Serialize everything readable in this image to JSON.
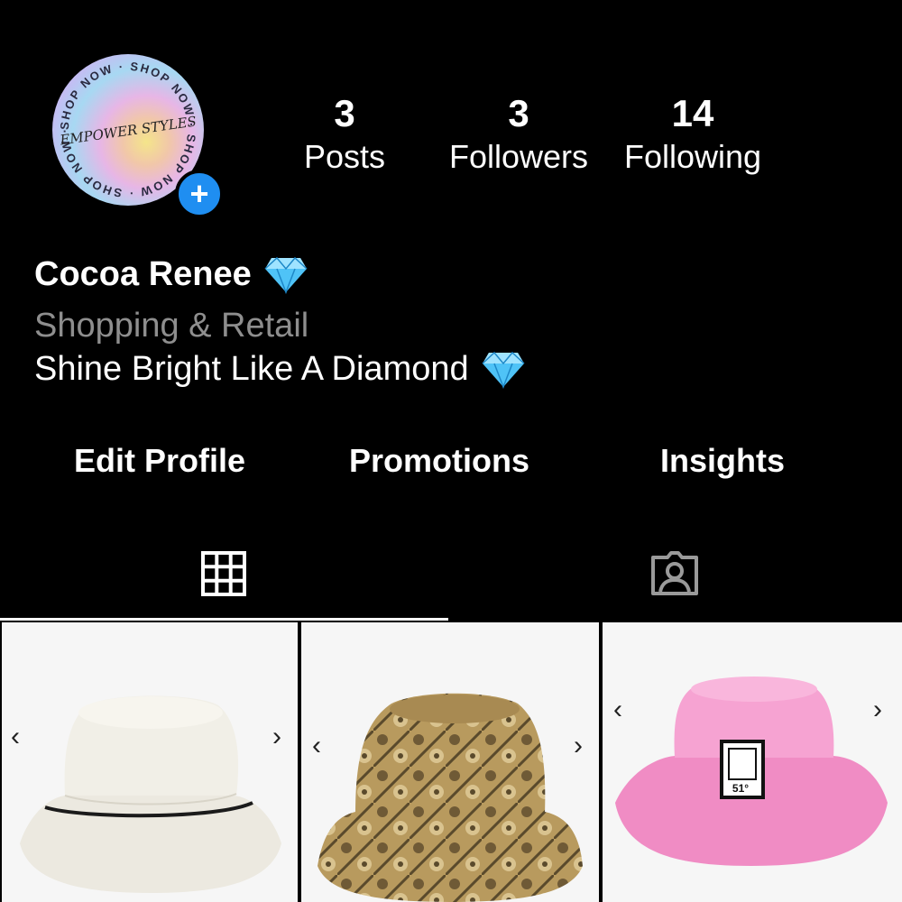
{
  "profile": {
    "avatar_text_top": "SHOP NOW · SHOP NOW · SHOP NOW · SHOP NOW ·",
    "avatar_brand": "EMPOWER STYLES",
    "add_label": "+",
    "name": "Cocoa Renee",
    "category": "Shopping & Retail",
    "bio": "Shine Bright Like A Diamond"
  },
  "stats": [
    {
      "count": "3",
      "label": "Posts"
    },
    {
      "count": "3",
      "label": "Followers"
    },
    {
      "count": "14",
      "label": "Following"
    }
  ],
  "actions": {
    "edit": "Edit Profile",
    "promotions": "Promotions",
    "insights": "Insights"
  },
  "tabs": [
    {
      "icon": "grid-icon",
      "active": true
    },
    {
      "icon": "tagged-icon",
      "active": false
    }
  ],
  "posts": [
    {
      "item": "white bucket hat",
      "label": ""
    },
    {
      "item": "paisley bucket hat",
      "label": ""
    },
    {
      "item": "pink bucket hat",
      "label": "51°"
    }
  ],
  "carousel": {
    "prev": "‹",
    "next": "›"
  },
  "colors": {
    "accent": "#1f8ef1",
    "category": "#8e8e8e",
    "diamond": "#4fc3f7"
  }
}
